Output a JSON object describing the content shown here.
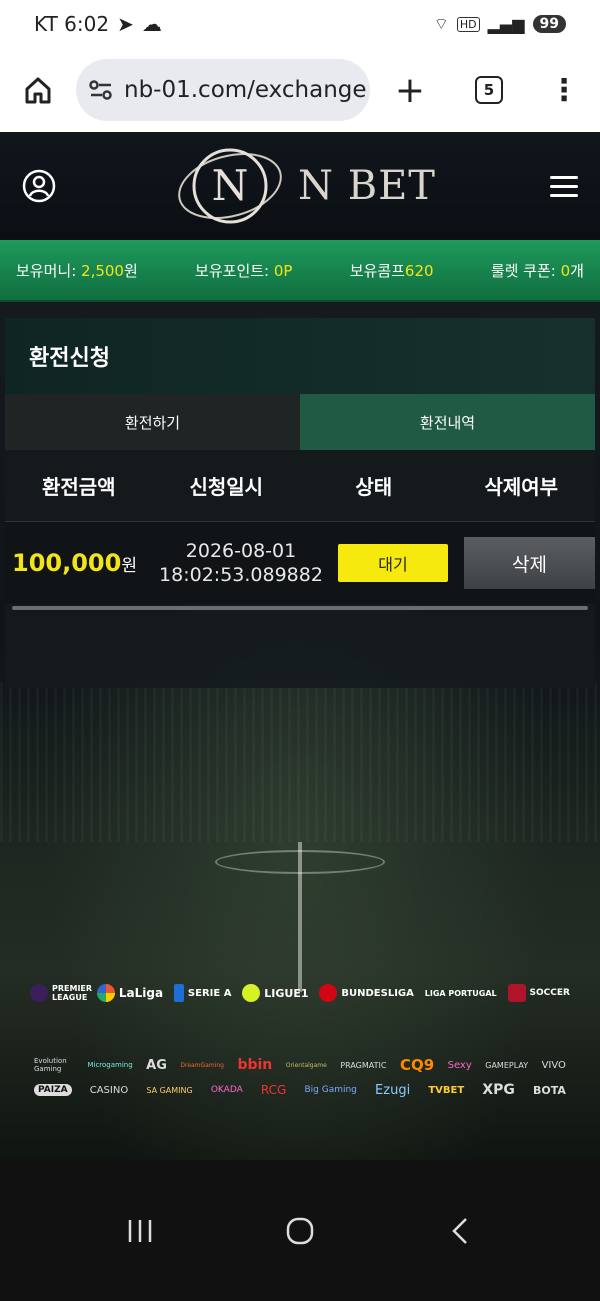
{
  "status_bar": {
    "carrier_time": "KT 6:02",
    "network": "HD",
    "battery": "99"
  },
  "browser": {
    "url": "nb-01.com/exchange",
    "tab_count": "5",
    "new_tab": "+",
    "menu": "⋮"
  },
  "site": {
    "brand": "N BET"
  },
  "money_bar": {
    "money_label": "보유머니: ",
    "money_value": "2,500",
    "money_unit": "원",
    "point_label": "보유포인트: ",
    "point_value": "0P",
    "comp_label": "보유콤프",
    "comp_value": "620",
    "coupon_label": "룰렛 쿠폰: ",
    "coupon_value": "0",
    "coupon_unit": "개"
  },
  "panel": {
    "title": "환전신청",
    "tabs": [
      "환전하기",
      "환전내역"
    ],
    "columns": [
      "환전금액",
      "신청일시",
      "상태",
      "삭제여부"
    ],
    "rows": [
      {
        "amount": "100,000",
        "unit": "원",
        "date": "2026-08-01",
        "time": "18:02:53.089882",
        "status": "대기",
        "delete": "삭제"
      }
    ]
  },
  "leagues": [
    "PREMIER LEAGUE",
    "LaLiga",
    "SERIE A",
    "LIGUE1",
    "BUNDESLIGA",
    "LIGA PORTUGAL",
    "SOCCER"
  ],
  "vendors_row1": [
    "Evolution Gaming",
    "Microgaming",
    "AG",
    "DreamGaming",
    "bbin",
    "Orientalgame",
    "PRAGMATIC",
    "CQ9",
    "Sexy",
    "GAMEPLAY",
    "VIVO"
  ],
  "vendors_row2": [
    "PAIZA",
    "CASINO",
    "SA GAMING",
    "OKADA",
    "RCG",
    "Big Gaming",
    "Ezugi",
    "TVBET",
    "XPG",
    "BOTA"
  ]
}
